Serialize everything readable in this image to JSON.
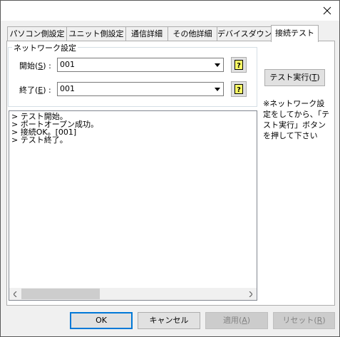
{
  "tabs": [
    "パソコン側設定",
    "ユニット側設定",
    "通信詳細",
    "その他詳細",
    "デバイスダウン",
    "接続テスト"
  ],
  "group": {
    "title": "ネットワーク設定",
    "start": {
      "label": "開始",
      "accel": "S",
      "suffix": ") :",
      "value": "001"
    },
    "end": {
      "label": "終了",
      "accel": "E",
      "suffix": ") :",
      "value": "001"
    }
  },
  "test_button": {
    "label": "テスト実行",
    "accel": "T"
  },
  "note": "※ネットワーク設定をしてから、「テスト実行」ボタンを押して下さい",
  "log_lines": [
    "> テスト開始。",
    "> ポートオープン成功。",
    "> 接続OK。[001]",
    "> テスト終了。"
  ],
  "buttons": {
    "ok": "OK",
    "cancel": "キャンセル",
    "apply": {
      "label": "適用",
      "accel": "A"
    },
    "reset": {
      "label": "リセット",
      "accel": "R"
    }
  }
}
